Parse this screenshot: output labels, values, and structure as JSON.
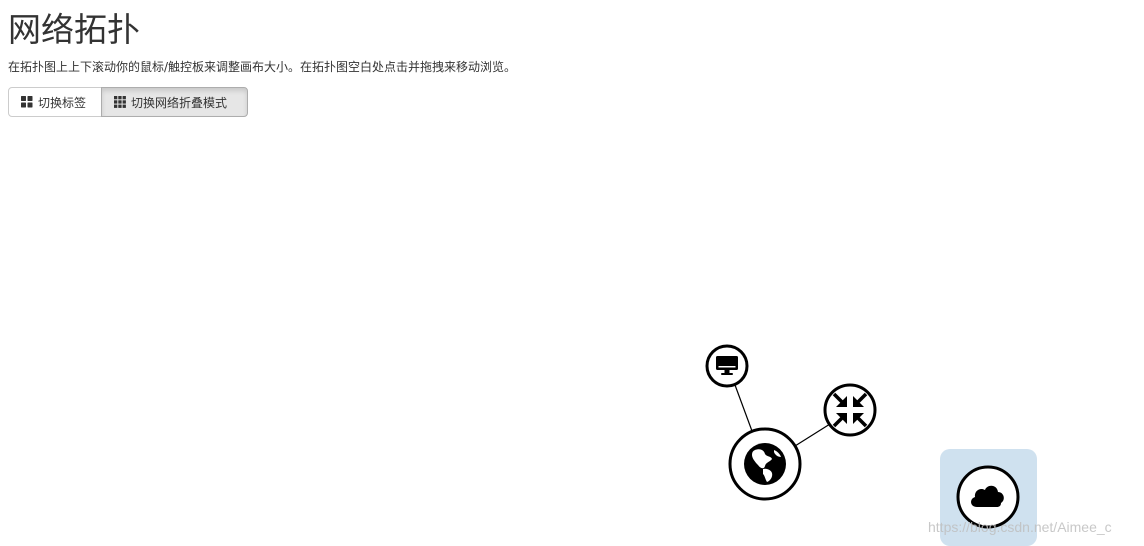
{
  "page": {
    "title": "网络拓扑",
    "instructions": "在拓扑图上上下滚动你的鼠标/触控板来调整画布大小。在拓扑图空白处点击并拖拽来移动浏览。"
  },
  "toolbar": {
    "toggle_labels": {
      "label": "切换标签",
      "icon": "th-large-icon"
    },
    "toggle_network_collapse": {
      "label": "切换网络折叠模式",
      "icon": "th-icon",
      "active": true
    }
  },
  "topology": {
    "nodes": [
      {
        "name": "node-instance",
        "icon": "desktop-icon"
      },
      {
        "name": "node-router",
        "icon": "compress-arrows-icon"
      },
      {
        "name": "node-network",
        "icon": "globe-icon"
      },
      {
        "name": "node-external",
        "icon": "cloud-icon",
        "selected": true
      }
    ],
    "links": [
      [
        "node-instance",
        "node-network"
      ],
      [
        "node-router",
        "node-network"
      ]
    ],
    "selected_highlight_color": "#cfe1ef"
  },
  "watermark": "https://blog.csdn.net/Aimee_c"
}
